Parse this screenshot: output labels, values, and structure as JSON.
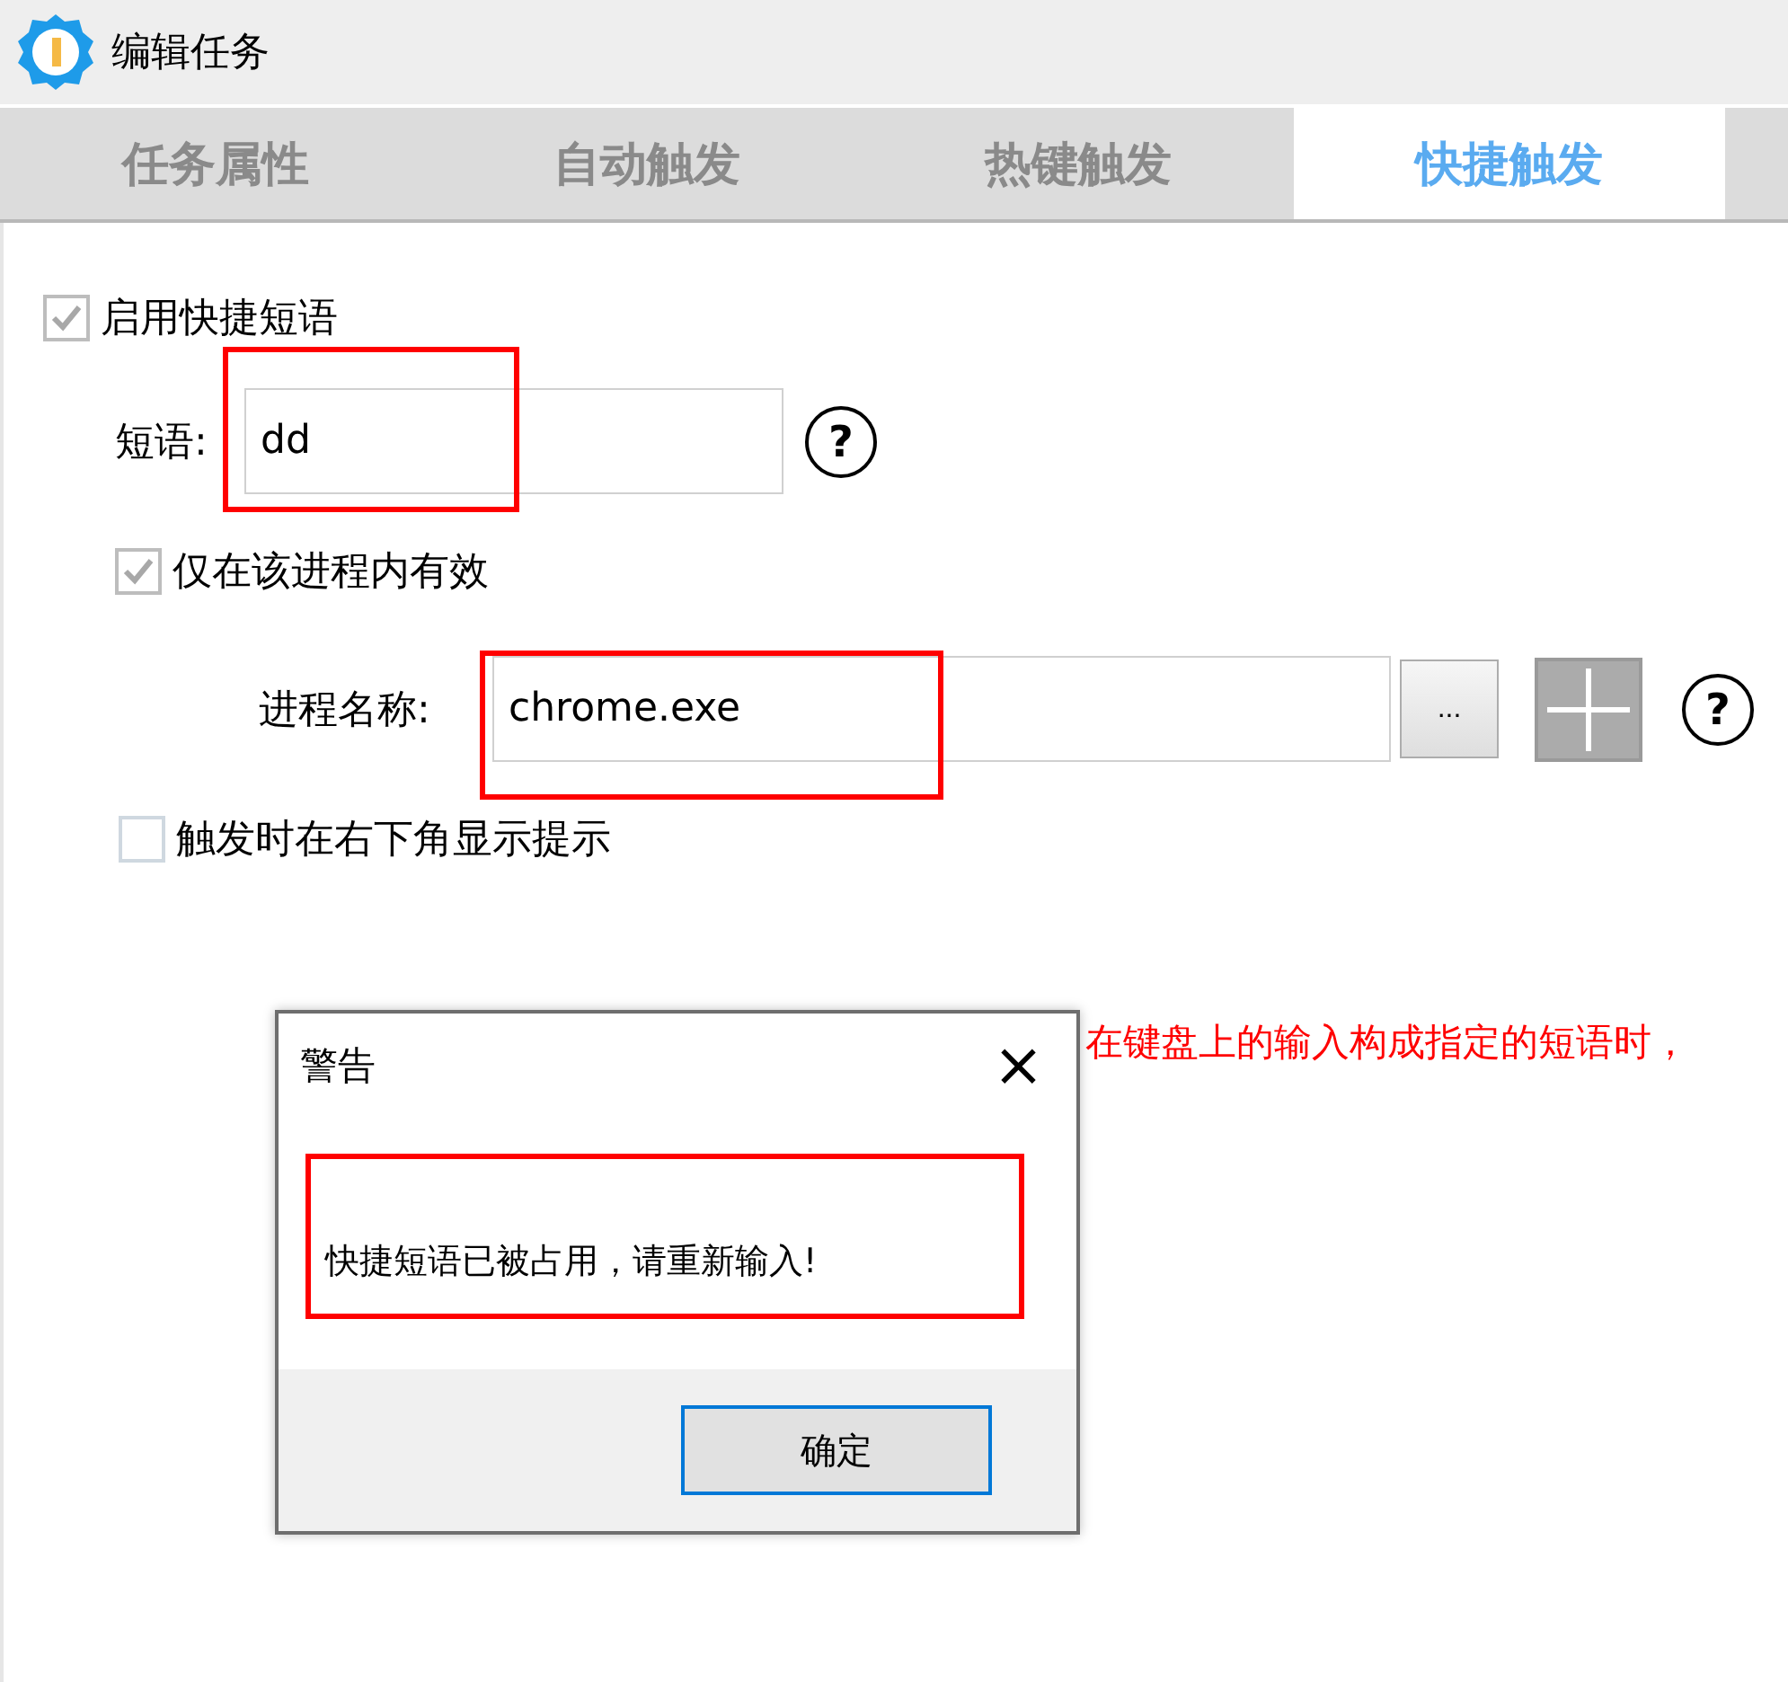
{
  "window": {
    "title": "编辑任务"
  },
  "tabs": [
    {
      "label": "任务属性",
      "selected": false
    },
    {
      "label": "自动触发",
      "selected": false
    },
    {
      "label": "热键触发",
      "selected": false
    },
    {
      "label": "快捷触发",
      "selected": true
    }
  ],
  "enable_phrase": {
    "label": "启用快捷短语",
    "checked": true,
    "disabled": true
  },
  "phrase": {
    "label": "短语:",
    "value": "dd",
    "highlighted": true,
    "help": "?"
  },
  "process_only": {
    "label": "仅在该进程内有效",
    "checked": true,
    "disabled": true
  },
  "process": {
    "label": "进程名称:",
    "value": "chrome.exe",
    "highlighted": true,
    "browse": "...",
    "help": "?"
  },
  "show_tip": {
    "label": "触发时在右下角显示提示",
    "checked": false,
    "disabled": false
  },
  "note": "在键盘上的输入构成指定的短语时，",
  "dialog": {
    "title": "警告",
    "close": "×",
    "message": "快捷短语已被占用，请重新输入!",
    "highlighted": true,
    "button": "确定"
  }
}
